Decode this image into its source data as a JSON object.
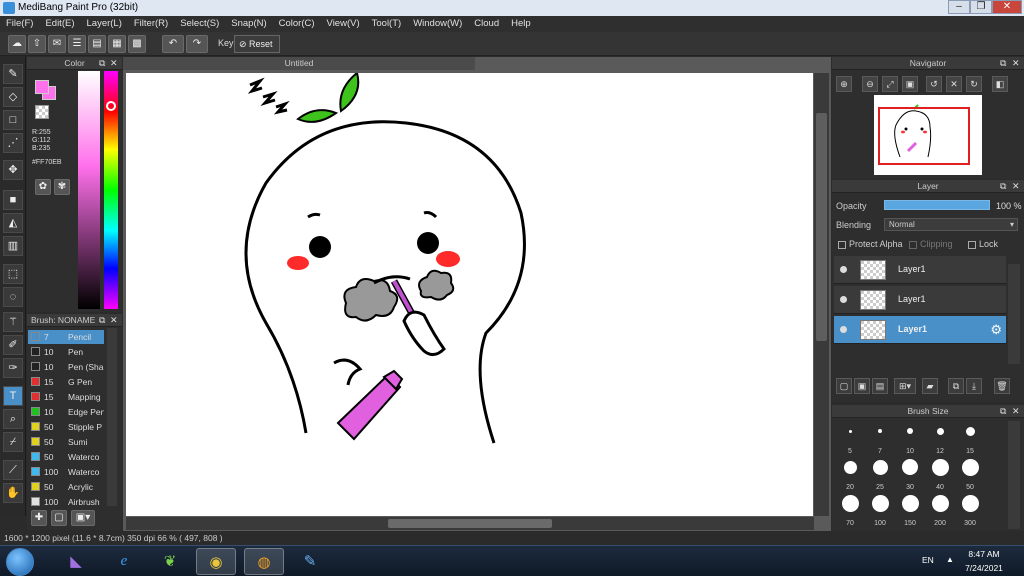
{
  "titlebar": {
    "title": "MediBang Paint Pro (32bit)",
    "minimize": "–",
    "maximize": "❐",
    "close": "✕"
  },
  "menu": [
    "File(F)",
    "Edit(E)",
    "Layer(L)",
    "Filter(R)",
    "Select(S)",
    "Snap(N)",
    "Color(C)",
    "View(V)",
    "Tool(T)",
    "Window(W)",
    "Cloud",
    "Help"
  ],
  "toolbar": {
    "key_label": "Key",
    "reset_label": "Reset"
  },
  "color_panel": {
    "title": "Color",
    "r": "R:255",
    "g": "G:112",
    "b": "B:235",
    "hex": "#FF70EB",
    "accent": "#ff70eb"
  },
  "brush_panel": {
    "title": "Brush: NONAME",
    "items": [
      {
        "size": "7",
        "name": "Pencil",
        "color": "#4a90c8"
      },
      {
        "size": "10",
        "name": "Pen",
        "color": "#222222"
      },
      {
        "size": "10",
        "name": "Pen (Sha",
        "color": "#222222"
      },
      {
        "size": "15",
        "name": "G Pen",
        "color": "#e03030"
      },
      {
        "size": "15",
        "name": "Mapping",
        "color": "#e03030"
      },
      {
        "size": "10",
        "name": "Edge Pen",
        "color": "#20c020"
      },
      {
        "size": "50",
        "name": "Stipple P",
        "color": "#e0d020"
      },
      {
        "size": "50",
        "name": "Sumi",
        "color": "#e0d020"
      },
      {
        "size": "50",
        "name": "Waterco",
        "color": "#40b8f0"
      },
      {
        "size": "100",
        "name": "Waterco",
        "color": "#40b8f0"
      },
      {
        "size": "50",
        "name": "Acrylic",
        "color": "#e0d020"
      },
      {
        "size": "100",
        "name": "Airbrush",
        "color": "#e0e0e0"
      }
    ]
  },
  "canvas": {
    "tab_title": "Untitled"
  },
  "navigator": {
    "title": "Navigator"
  },
  "layer_panel": {
    "title": "Layer",
    "opacity_label": "Opacity",
    "opacity_value": "100 %",
    "blending_label": "Blending",
    "blending_value": "Normal",
    "protect_alpha": "Protect Alpha",
    "clipping": "Clipping",
    "lock": "Lock",
    "layers": [
      "Layer1",
      "Layer1",
      "Layer1"
    ]
  },
  "brush_size_panel": {
    "title": "Brush Size",
    "sizes": [
      "5",
      "7",
      "10",
      "12",
      "15",
      "20",
      "25",
      "30",
      "40",
      "50",
      "70",
      "100",
      "150",
      "200",
      "300"
    ]
  },
  "status": {
    "text": "1600 * 1200 pixel  (11.6 * 8.7cm)  350 dpi  66 %  ( 497, 808 )"
  },
  "taskbar": {
    "lang": "EN",
    "time": "8:47 AM",
    "date": "7/24/2021"
  }
}
